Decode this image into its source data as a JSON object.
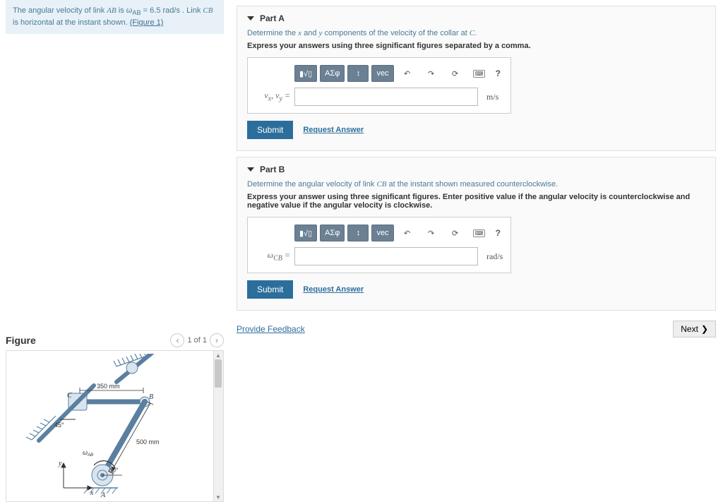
{
  "problem": {
    "text_pre": "The angular velocity of link ",
    "link1": "AB",
    "text_mid1": " is ω",
    "sub1": "AB",
    "text_mid2": " = 6.5 ",
    "unit": "rad/s",
    "text_mid3": " . Link ",
    "link2": "CB",
    "text_post": " is horizontal at the instant shown. ",
    "figure_link": "(Figure 1)"
  },
  "partA": {
    "title": "Part A",
    "instruction_pre": "Determine the ",
    "var_x": "x",
    "instruction_mid": " and ",
    "var_y": "y",
    "instruction_post": " components of the velocity of the collar at ",
    "var_C": "C",
    "instruction_end": ".",
    "bold": "Express your answers using three significant figures separated by a comma.",
    "toolbar": {
      "templates": "▮√▯",
      "greek": "ΑΣφ",
      "subsup": "↕",
      "vec": "vec"
    },
    "var_label": "vₓ, v_y =",
    "unit": "m/s",
    "submit": "Submit",
    "request": "Request Answer"
  },
  "partB": {
    "title": "Part B",
    "instruction_pre": "Determine the angular velocity of link ",
    "link": "CB",
    "instruction_post": " at the instant shown measured counterclockwise.",
    "bold": "Express your answer using three significant figures. Enter positive value if the angular velocity is counterclockwise and negative value if the angular velocity is clockwise.",
    "toolbar": {
      "templates": "▮√▯",
      "greek": "ΑΣφ",
      "subsup": "↕",
      "vec": "vec"
    },
    "var_label": "ω_CB =",
    "unit": "rad/s",
    "submit": "Submit",
    "request": "Request Answer"
  },
  "footer": {
    "feedback": "Provide Feedback",
    "next": "Next"
  },
  "figure": {
    "title": "Figure",
    "page": "1 of 1",
    "labels": {
      "len350": "350 mm",
      "len500": "500 mm",
      "ang45": "45°",
      "ang60": "60°",
      "omega": "ω_AB",
      "A": "A",
      "B": "B",
      "C": "C",
      "x": "x",
      "y": "y"
    }
  },
  "icons": {
    "undo": "↶",
    "redo": "↷",
    "reset": "⟳",
    "keyboard": "⌨",
    "help": "?",
    "chevron": "❯",
    "chev_l": "‹",
    "chev_r": "›"
  }
}
